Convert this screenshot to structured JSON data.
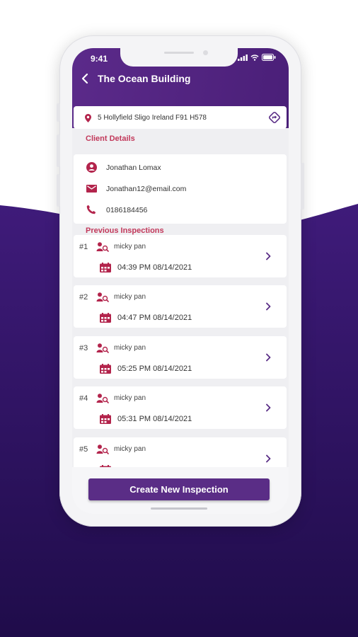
{
  "colors": {
    "accent": "#4a1f78",
    "label_red": "#c2385a",
    "icon_red": "#b3244c",
    "background_purple": "#3a1670"
  },
  "status_bar": {
    "time": "9:41"
  },
  "header": {
    "title": "The Ocean Building",
    "back_icon": "chevron-left-icon"
  },
  "address": {
    "text": "5 Hollyfield Sligo Ireland F91 H578",
    "pin_icon": "location-pin-icon",
    "directions_icon": "directions-icon"
  },
  "client_details": {
    "label": "Client Details",
    "name": "Jonathan Lomax",
    "email": "Jonathan12@email.com",
    "phone": "0186184456"
  },
  "previous_inspections": {
    "label": "Previous Inspections",
    "items": [
      {
        "number": "#1",
        "inspector": "micky pan",
        "datetime": "04:39 PM 08/14/2021"
      },
      {
        "number": "#2",
        "inspector": "micky pan",
        "datetime": "04:47 PM 08/14/2021"
      },
      {
        "number": "#3",
        "inspector": "micky pan",
        "datetime": "05:25 PM 08/14/2021"
      },
      {
        "number": "#4",
        "inspector": "micky pan",
        "datetime": "05:31 PM 08/14/2021"
      },
      {
        "number": "#5",
        "inspector": "micky pan",
        "datetime": ""
      }
    ]
  },
  "actions": {
    "create_label": "Create New Inspection"
  }
}
